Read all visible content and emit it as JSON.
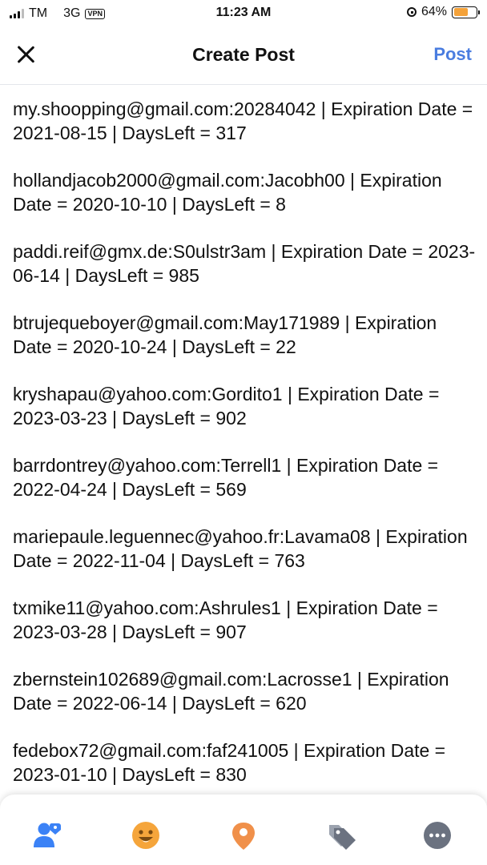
{
  "status_bar": {
    "carrier": "TM",
    "network": "3G",
    "vpn": "VPN",
    "time": "11:23 AM",
    "battery": "64%",
    "battery_level": 0.64
  },
  "header": {
    "title": "Create Post",
    "post_label": "Post",
    "accent_color": "#4a7de0"
  },
  "entries": [
    "my.shoopping@gmail.com:20284042 | Expiration Date = 2021-08-15 | DaysLeft = 317",
    "hollandjacob2000@gmail.com:Jacobh00 | Expiration Date = 2020-10-10 | DaysLeft = 8",
    "paddi.reif@gmx.de:S0ulstr3am | Expiration Date = 2023-06-14 | DaysLeft = 985",
    "btrujequeboyer@gmail.com:May171989 | Expiration Date = 2020-10-24 | DaysLeft = 22",
    "kryshapau@yahoo.com:Gordito1 | Expiration Date = 2023-03-23 | DaysLeft = 902",
    "barrdontrey@yahoo.com:Terrell1 | Expiration Date = 2022-04-24 | DaysLeft = 569",
    "mariepaule.leguennec@yahoo.fr:Lavama08 | Expiration Date = 2022-11-04 | DaysLeft = 763",
    "txmike11@yahoo.com:Ashrules1 | Expiration Date = 2023-03-28 | DaysLeft = 907",
    "zbernstein102689@gmail.com:Lacrosse1 | Expiration Date = 2022-06-14 | DaysLeft = 620",
    "fedebox72@gmail.com:faf241005 | Expiration Date = 2023-01-10 | DaysLeft = 830"
  ],
  "bottom_bar": {
    "icons": [
      "tag-people-icon",
      "feeling-icon",
      "location-icon",
      "tag-icon",
      "more-icon"
    ],
    "colors": {
      "tag_people": "#3b82f6",
      "feeling": "#f5a53b",
      "location": "#f0904a",
      "tag": "#6b7280",
      "more": "#6b7280"
    }
  }
}
